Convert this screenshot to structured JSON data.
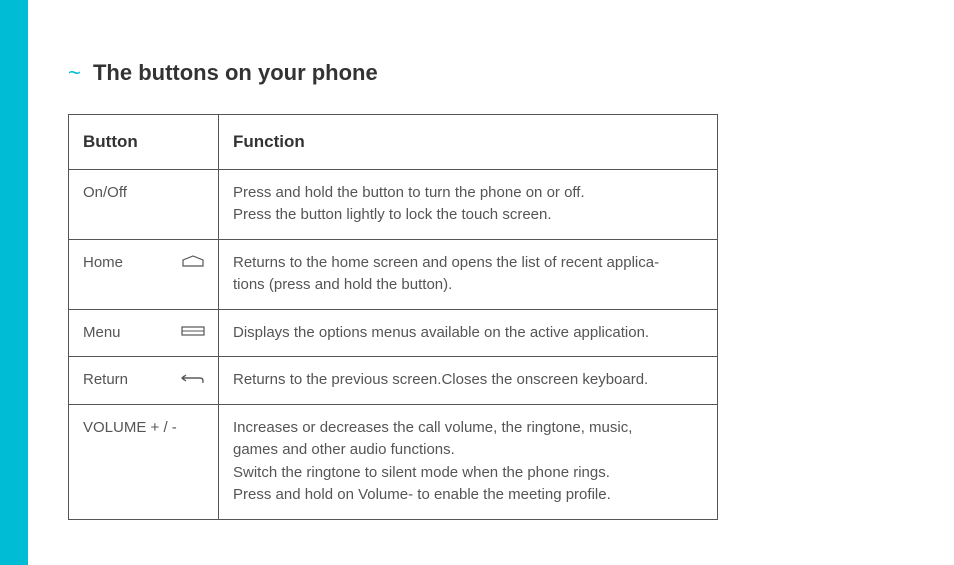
{
  "heading": {
    "prefix": "~",
    "title": "The buttons on your phone"
  },
  "table": {
    "headers": {
      "button": "Button",
      "function": "Function"
    },
    "rows": [
      {
        "button_label": "On/Off",
        "icon": null,
        "function_lines": [
          "Press and hold the button to turn the phone on or off.",
          "Press the button lightly to lock the touch screen."
        ]
      },
      {
        "button_label": "Home",
        "icon": "home-icon",
        "function_lines": [
          "Returns to the home screen and opens the list of recent applica-",
          "tions (press and hold the button)."
        ]
      },
      {
        "button_label": "Menu",
        "icon": "menu-icon",
        "function_lines": [
          "Displays the options menus available on the active application."
        ]
      },
      {
        "button_label": "Return",
        "icon": "return-icon",
        "function_lines": [
          "Returns to the previous screen.Closes the onscreen keyboard."
        ]
      },
      {
        "button_label": "VOLUME + / -",
        "icon": null,
        "function_lines": [
          "Increases or decreases the call volume, the ringtone, music,",
          "games and other audio functions.",
          "Switch the ringtone to silent mode when the phone rings.",
          "Press and hold on Volume- to enable the meeting profile."
        ]
      }
    ]
  }
}
